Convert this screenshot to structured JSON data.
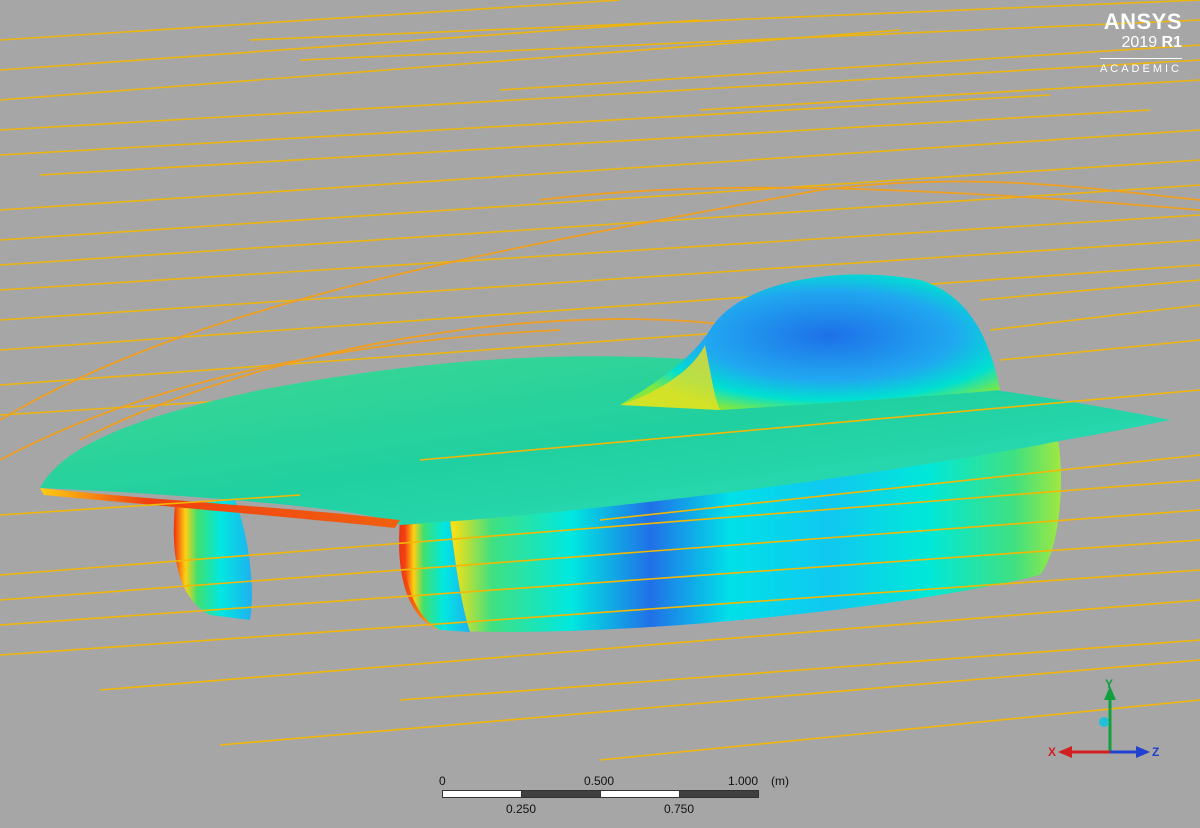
{
  "logo": {
    "brand": "ANSYS",
    "version_year": "2019",
    "version_release": "R1",
    "edition": "ACADEMIC"
  },
  "scale_bar": {
    "top_labels": [
      "0",
      "0.500",
      "1.000"
    ],
    "unit": "(m)",
    "bottom_labels": [
      "0.250",
      "0.750"
    ]
  },
  "triad": {
    "y_label": "Y",
    "x_label": "X",
    "z_label": "Z"
  },
  "colors": {
    "background": "#a6a6a6",
    "streamline": "#f2b705",
    "streamline_alt": "#f0a020",
    "contour_low": "#1e64e6",
    "contour_mid": "#00e8e0",
    "contour_green": "#44e070",
    "contour_high": "#f03010"
  }
}
